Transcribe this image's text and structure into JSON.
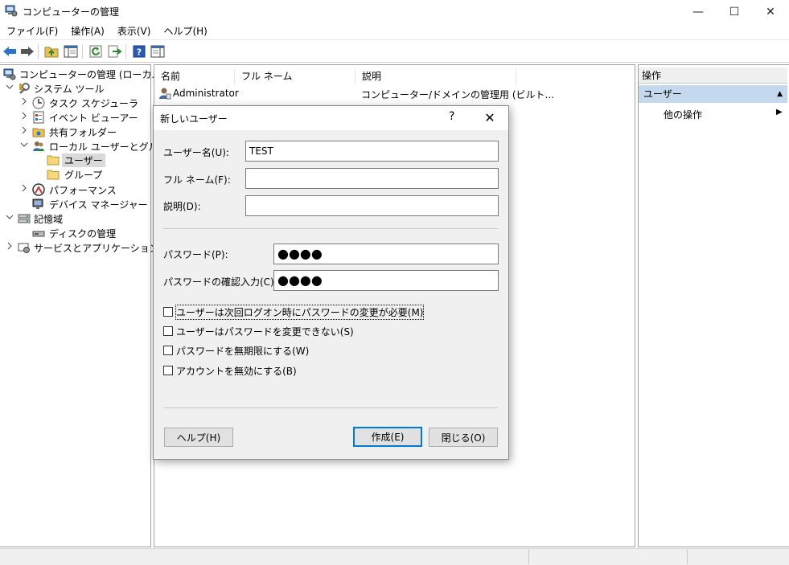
{
  "window": {
    "title": "コンピューターの管理",
    "icon": "computer-management-icon",
    "controls": {
      "minimize": "—",
      "maximize": "☐",
      "close": "✕"
    }
  },
  "menu": [
    "ファイル(F)",
    "操作(A)",
    "表示(V)",
    "ヘルプ(H)"
  ],
  "toolbar": [
    "back-icon",
    "forward-icon",
    "up-folder-icon",
    "show-hide-tree-icon",
    "refresh-icon",
    "export-list-icon",
    "help-icon",
    "show-hide-action-pane-icon"
  ],
  "tree": [
    {
      "label": "コンピューターの管理 (ローカル)",
      "icon": "computer-management-icon",
      "chevron": ""
    },
    {
      "label": "システム ツール",
      "icon": "system-tools-icon",
      "chevron": "⌄"
    },
    {
      "label": "タスク スケジューラ",
      "icon": "clock-icon",
      "chevron": "›"
    },
    {
      "label": "イベント ビューアー",
      "icon": "event-viewer-icon",
      "chevron": "›"
    },
    {
      "label": "共有フォルダー",
      "icon": "shared-folder-icon",
      "chevron": "›"
    },
    {
      "label": "ローカル ユーザーとグループ",
      "icon": "users-group-icon",
      "chevron": "⌄"
    },
    {
      "label": "ユーザー",
      "icon": "folder-icon",
      "chevron": ""
    },
    {
      "label": "グループ",
      "icon": "folder-icon",
      "chevron": ""
    },
    {
      "label": "パフォーマンス",
      "icon": "performance-icon",
      "chevron": "›"
    },
    {
      "label": "デバイス マネージャー",
      "icon": "device-manager-icon",
      "chevron": ""
    },
    {
      "label": "記憶域",
      "icon": "storage-icon",
      "chevron": "⌄"
    },
    {
      "label": "ディスクの管理",
      "icon": "disk-icon",
      "chevron": ""
    },
    {
      "label": "サービスとアプリケーション",
      "icon": "services-icon",
      "chevron": "›"
    }
  ],
  "list": {
    "columns": [
      "名前",
      "フル ネーム",
      "説明"
    ],
    "rows": [
      {
        "name": "Administrator",
        "full_name": "",
        "description": "コンピューター/ドメインの管理用 (ビルト..."
      }
    ]
  },
  "actions": {
    "header": "操作",
    "section": "ユーザー",
    "item": "他の操作"
  },
  "dialog": {
    "title": "新しいユーザー",
    "help_glyph": "?",
    "close_glyph": "✕",
    "fields": {
      "username": {
        "label": "ユーザー名(U):",
        "value": "TEST"
      },
      "fullname": {
        "label": "フル ネーム(F):",
        "value": ""
      },
      "description": {
        "label": "説明(D):",
        "value": ""
      },
      "password": {
        "label": "パスワード(P):",
        "value": "●●●●"
      },
      "confirm": {
        "label": "パスワードの確認入力(C):",
        "value": "●●●●"
      }
    },
    "checkboxes": [
      {
        "label": "ユーザーは次回ログオン時にパスワードの変更が必要(M)",
        "checked": false
      },
      {
        "label": "ユーザーはパスワードを変更できない(S)",
        "checked": false
      },
      {
        "label": "パスワードを無期限にする(W)",
        "checked": false
      },
      {
        "label": "アカウントを無効にする(B)",
        "checked": false
      }
    ],
    "buttons": {
      "help": "ヘルプ(H)",
      "create": "作成(E)",
      "close": "閉じる(O)"
    }
  },
  "colors": {
    "selection": "#c5d9ee",
    "accent": "#0078d7",
    "dialog_bg": "#f0f0f0"
  }
}
